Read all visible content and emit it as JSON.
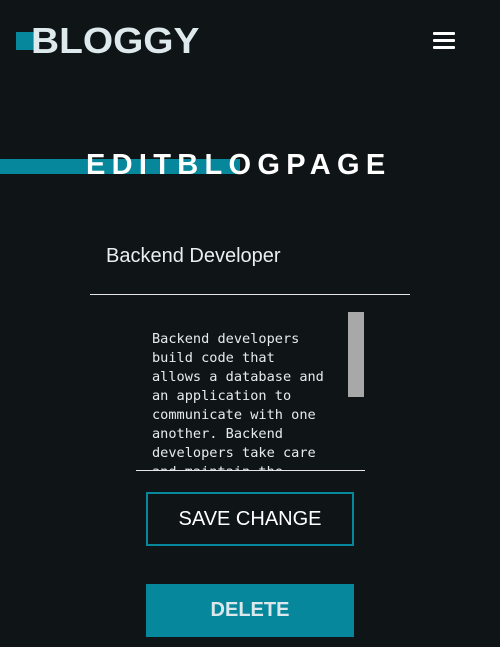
{
  "header": {
    "logo_text": "BLOGGY",
    "menu_icon": "hamburger-menu-icon"
  },
  "page": {
    "title": "EDITBLOGPAGE"
  },
  "form": {
    "title_value": "Backend Developer",
    "content_value": "Backend developers build code that allows a database and an application to communicate with one another. Backend developers take care and maintain the"
  },
  "actions": {
    "save_label": "SAVE CHANGE",
    "delete_label": "DELETE"
  },
  "colors": {
    "background": "#0f1516",
    "accent": "#07879b",
    "text": "#ffffff"
  }
}
